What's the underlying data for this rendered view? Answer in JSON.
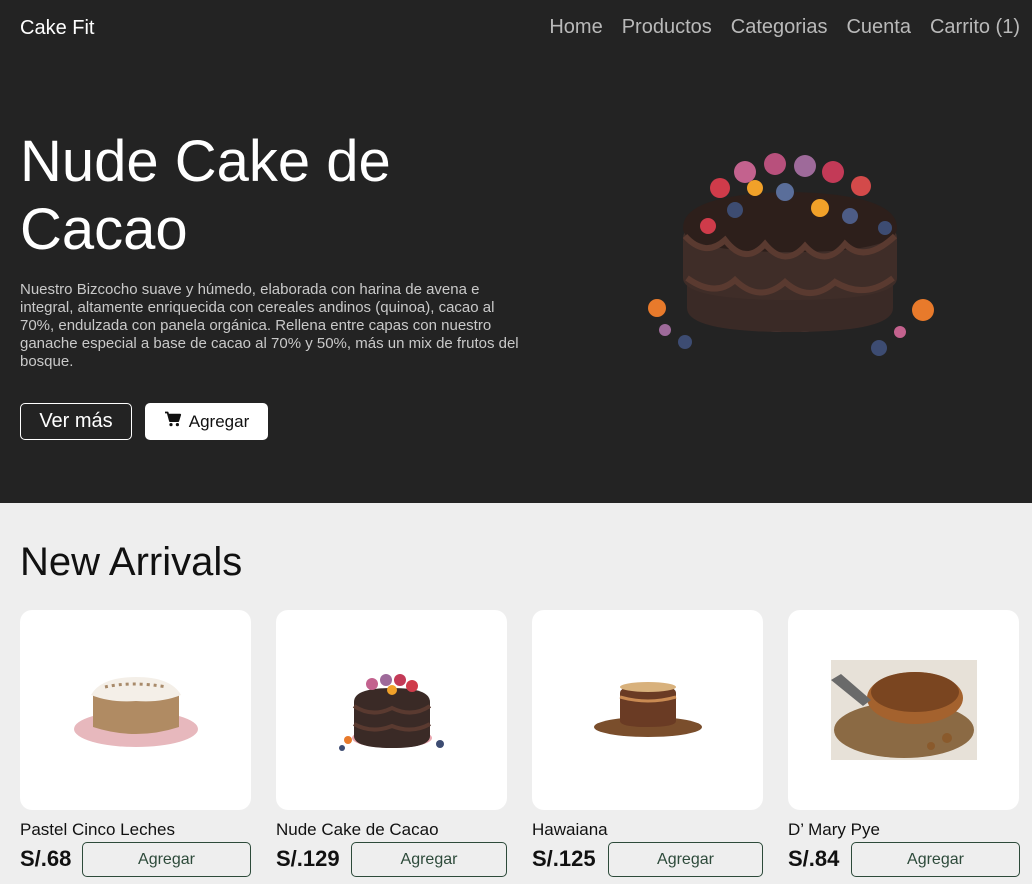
{
  "header": {
    "brand": "Cake Fit",
    "nav": [
      "Home",
      "Productos",
      "Categorias",
      "Cuenta",
      "Carrito (1)"
    ]
  },
  "hero": {
    "title": "Nude Cake de Cacao",
    "description": "Nuestro Bizcocho suave y húmedo, elaborada con harina de avena e integral, altamente enriquecida con cereales andinos (quinoa), cacao al 70%, endulzada con panela orgánica. Rellena entre capas con nuestro ganache especial a base de cacao al 70% y 50%, más un mix de frutos del bosque.",
    "more_label": "Ver más",
    "add_label": "Agregar",
    "add_icon": "cart-icon"
  },
  "section": {
    "title": "New Arrivals"
  },
  "products": [
    {
      "name": "Pastel Cinco Leches",
      "price": "S/.68",
      "button": "Agregar"
    },
    {
      "name": "Nude Cake de Cacao",
      "price": "S/.129",
      "button": "Agregar"
    },
    {
      "name": "Hawaiana",
      "price": "S/.125",
      "button": "Agregar"
    },
    {
      "name": "D’ Mary Pye",
      "price": "S/.84",
      "button": "Agregar"
    }
  ],
  "colors": {
    "hero_bg": "#232323",
    "page_bg": "#eeeeee",
    "button_border": "#2d4a3a"
  }
}
